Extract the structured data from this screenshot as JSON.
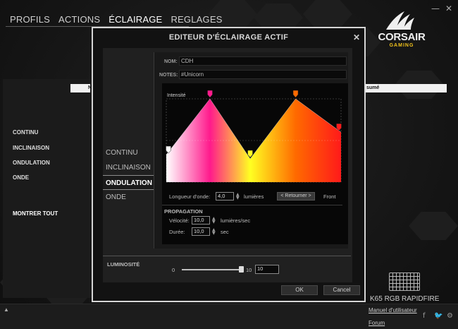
{
  "nav": {
    "items": [
      {
        "label": "PROFILS",
        "active": false
      },
      {
        "label": "ACTIONS",
        "active": false
      },
      {
        "label": "ÉCLAIRAGE",
        "active": true
      },
      {
        "label": "REGLAGES",
        "active": false
      }
    ]
  },
  "window": {
    "minimize_glyph": "—",
    "close_glyph": "✕"
  },
  "brand": {
    "name": "CORSAIR",
    "sub": "GAMING",
    "accent": "#f2c21b"
  },
  "background": {
    "sidebar_items": [
      "CONTINU",
      "INCLINAISON",
      "ONDULATION",
      "ONDE"
    ],
    "show_all": "MONTRER TOUT",
    "header_fragments": [
      "N",
      "sumé"
    ]
  },
  "device": {
    "name": "K65 RGB RAPIDFIRE"
  },
  "footer": {
    "manual": "Manuel d'utilisateur",
    "forum": "Forum",
    "up": "▲",
    "social_icons": [
      "facebook-icon",
      "twitter-icon",
      "gear-icon"
    ]
  },
  "modal": {
    "title": "EDITEUR D'ÉCLAIRAGE ACTIF",
    "close": "✕",
    "effects": [
      {
        "label": "CONTINU",
        "active": false
      },
      {
        "label": "INCLINAISON",
        "active": false
      },
      {
        "label": "ONDULATION",
        "active": true
      },
      {
        "label": "ONDE",
        "active": false
      }
    ],
    "name_label": "NOM:",
    "name_value": "CDH",
    "notes_label": "NOTES:",
    "notes_value": "#Unicorn",
    "intensity_label": "Intensité",
    "wavelength_label": "Longueur d'onde:",
    "wavelength_value": "4,0",
    "wavelength_unit": "lumières",
    "reverse_button": "< Retourner >",
    "front_label": "Front",
    "propagation_title": "PROPAGATION",
    "velocity_label": "Vélocité:",
    "velocity_value": "10,0",
    "velocity_unit": "lumières/sec",
    "duration_label": "Durée:",
    "duration_value": "10,0",
    "duration_unit": "sec",
    "brightness_title": "LUMINOSITÉ",
    "brightness_min": "0",
    "brightness_max": "10",
    "brightness_value": "10",
    "brightness_level": 1.0,
    "ok": "OK",
    "cancel": "Cancel"
  },
  "gradient": {
    "stops": [
      {
        "position": 0.0,
        "color": "#ffffff",
        "intensity": 0.33
      },
      {
        "position": 0.25,
        "color": "#ff1a8c",
        "intensity": 1.0
      },
      {
        "position": 0.48,
        "color": "#ffff22",
        "intensity": 0.28
      },
      {
        "position": 0.74,
        "color": "#ff6a00",
        "intensity": 1.0
      },
      {
        "position": 1.0,
        "color": "#ff1a1a",
        "intensity": 0.6
      }
    ]
  }
}
